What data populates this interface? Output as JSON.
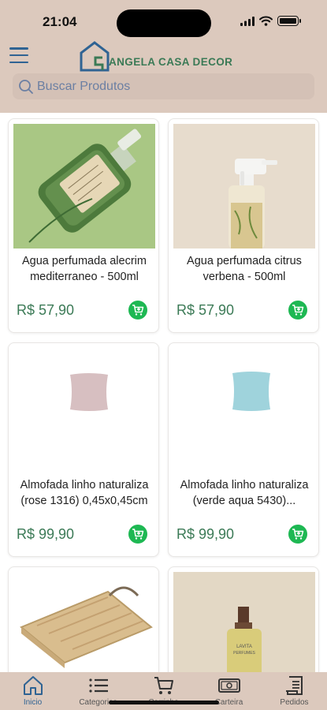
{
  "status_bar": {
    "time": "21:04"
  },
  "brand": {
    "name": "ANGELA CASA DECOR",
    "primary_color": "#2f6393",
    "accent_green": "#3b7a56",
    "header_bg": "#dcc9bd"
  },
  "search": {
    "placeholder": "Buscar Produtos"
  },
  "products": [
    {
      "name": "Agua perfumada alecrim mediterraneo - 500ml",
      "price": "R$ 57,90",
      "image": "green-bottle-photo"
    },
    {
      "name": "Agua perfumada citrus verbena - 500ml",
      "price": "R$ 57,90",
      "image": "spray-bottle-photo"
    },
    {
      "name": "Almofada linho naturaliza (rose 1316) 0,45x0,45cm",
      "price": "R$ 99,90",
      "image": "pink-pillow"
    },
    {
      "name": "Almofada linho naturaliza (verde aqua 5430)...",
      "price": "R$ 99,90",
      "image": "aqua-pillow"
    },
    {
      "name": "",
      "price": "",
      "image": "wooden-tray-photo"
    },
    {
      "name": "",
      "price": "",
      "image": "perfume-bottle-photo"
    }
  ],
  "bottom_nav": [
    {
      "label": "Inicio",
      "icon": "home-icon",
      "active": true
    },
    {
      "label": "Categorias",
      "icon": "list-icon",
      "active": false
    },
    {
      "label": "Carrinho",
      "icon": "cart-icon",
      "active": false
    },
    {
      "label": "Carteira",
      "icon": "wallet-icon",
      "active": false
    },
    {
      "label": "Pedidos",
      "icon": "receipt-icon",
      "active": false
    }
  ]
}
